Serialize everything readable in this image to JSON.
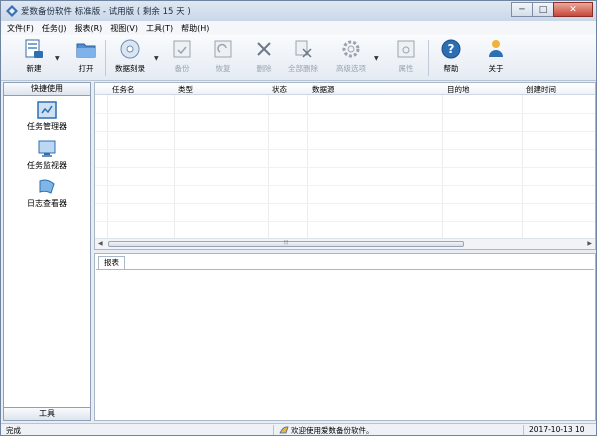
{
  "window": {
    "title": "爱数备份软件 标准版 - 试用版 ( 剩余 15 天 )",
    "controls": {
      "minimize": "─",
      "maximize": "□",
      "close": "✕"
    }
  },
  "menu": [
    "文件(F)",
    "任务(J)",
    "报表(R)",
    "视图(V)",
    "工具(T)",
    "帮助(H)"
  ],
  "toolbar": {
    "new": "新建",
    "open": "打开",
    "data_restore": "数据刻录",
    "backup": "备份",
    "restore": "恢复",
    "delete": "删除",
    "delete_all": "全部删除",
    "advanced": "高级选项",
    "properties": "属性",
    "help": "帮助",
    "about": "关于"
  },
  "left_panel": {
    "header": "快捷使用",
    "items": [
      "任务管理器",
      "任务监视器",
      "日志查看器"
    ],
    "footer": "工具"
  },
  "table": {
    "columns": [
      "任务名",
      "类型",
      "状态",
      "数据源",
      "目的地",
      "创建时间"
    ],
    "scroll_grip": "⦙⦙⦙"
  },
  "report": {
    "tab": "报表"
  },
  "status": {
    "left": "完成",
    "message": "欢迎使用爱数备份软件。",
    "datetime": "2017-10-13 10"
  },
  "colors": {
    "accent": "#2c6fb3",
    "frame": "#8ea0b8"
  }
}
